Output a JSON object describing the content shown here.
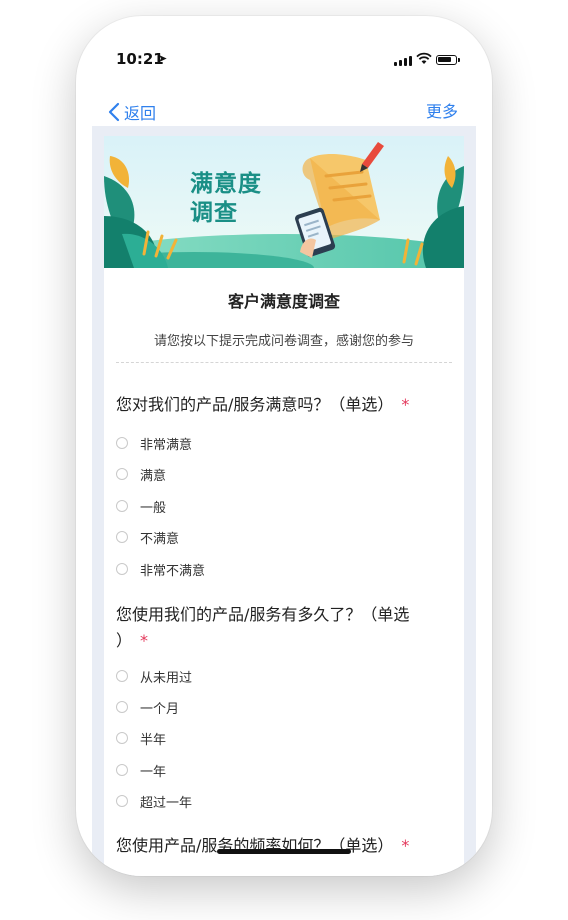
{
  "status_bar": {
    "time": "10:21",
    "location_icon": "location-arrow-icon",
    "signal_icon": "cellular-signal-icon",
    "wifi_icon": "wifi-icon",
    "battery_icon": "battery-icon"
  },
  "nav": {
    "back_label": "返回",
    "back_icon": "chevron-left-icon",
    "more_label": "更多",
    "accent": "#2f80ed"
  },
  "banner": {
    "title_line1": "满意度",
    "title_line2": "调查"
  },
  "survey": {
    "title": "客户满意度调查",
    "description": "请您按以下提示完成问卷调查，感谢您的参与"
  },
  "questions": [
    {
      "text": "您对我们的产品/服务满意吗？（单选）",
      "required_mark": "*",
      "options": [
        "非常满意",
        "满意",
        "一般",
        "不满意",
        "非常不满意"
      ]
    },
    {
      "text_line1": "您使用我们的产品/服务有多久了？（单选",
      "text_line2": "）",
      "required_mark": "*",
      "options": [
        "从未用过",
        "一个月",
        "半年",
        "一年",
        "超过一年"
      ]
    },
    {
      "text": "您使用产品/服务的频率如何？（单选）",
      "required_mark": "*"
    }
  ],
  "colors": {
    "required": "#e3385b",
    "banner_title": "#1a8f86"
  }
}
